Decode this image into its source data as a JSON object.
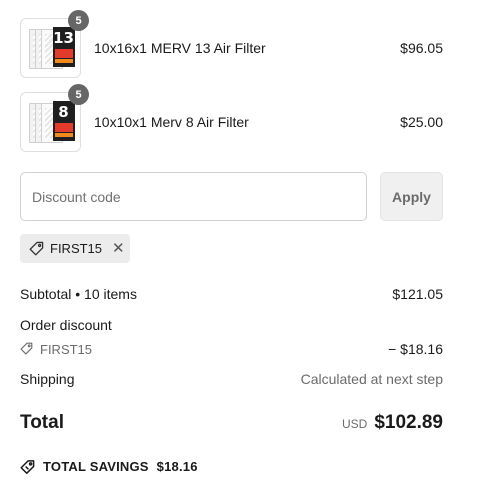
{
  "line_items": [
    {
      "name": "10x16x1 MERV 13 Air Filter",
      "price": "$96.05",
      "quantity": "5",
      "thumb_label": "13"
    },
    {
      "name": "10x10x1 Merv 8 Air Filter",
      "price": "$25.00",
      "quantity": "5",
      "thumb_label": "8"
    }
  ],
  "discount": {
    "placeholder": "Discount code",
    "value": "",
    "apply_label": "Apply",
    "applied_code": "FIRST15",
    "remove_glyph": "✕"
  },
  "summary": {
    "subtotal_label": "Subtotal • 10 items",
    "subtotal_value": "$121.05",
    "order_discount_label": "Order discount",
    "order_discount_code": "FIRST15",
    "order_discount_value": "− $18.16",
    "shipping_label": "Shipping",
    "shipping_value": "Calculated at next step",
    "total_label": "Total",
    "currency": "USD",
    "total_value": "$102.89",
    "savings_label": "TOTAL SAVINGS",
    "savings_value": "$18.16"
  },
  "colors": {
    "badge": "#666666",
    "muted_text": "#6b6b6b",
    "chip_bg": "#ececec",
    "apply_bg": "#f0f0f0",
    "filter_label_accent": "#e23a2b"
  },
  "icons": {
    "tag": "tag-icon",
    "remove": "close-icon",
    "savings": "price-tag-icon"
  }
}
